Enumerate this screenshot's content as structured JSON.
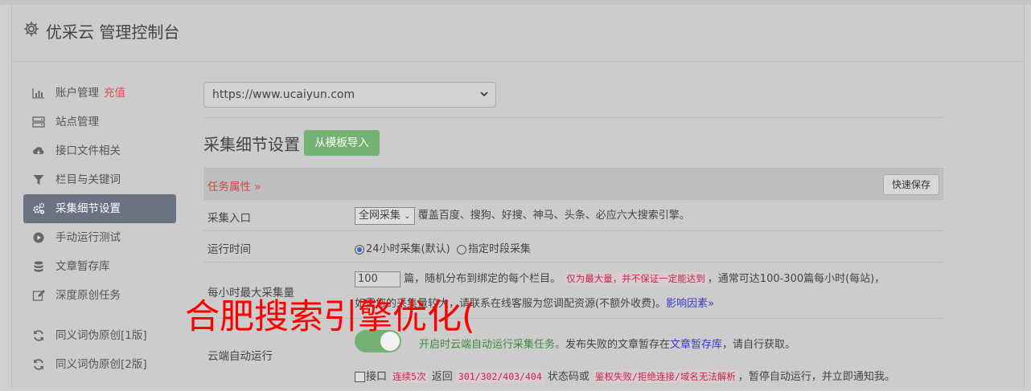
{
  "header": {
    "title": "优采云 管理控制台"
  },
  "sidebar": {
    "items": [
      {
        "label": "账户管理",
        "tag": "充值",
        "icon": "bar-chart-icon"
      },
      {
        "label": "站点管理",
        "icon": "server-icon"
      },
      {
        "label": "接口文件相关",
        "icon": "cloud-download-icon"
      },
      {
        "label": "栏目与关键词",
        "icon": "filter-icon"
      },
      {
        "label": "采集细节设置",
        "icon": "gears-icon",
        "active": true
      },
      {
        "label": "手动运行测试",
        "icon": "play-circle-icon"
      },
      {
        "label": "文章暂存库",
        "icon": "database-icon"
      },
      {
        "label": "深度原创任务",
        "icon": "edit-icon"
      },
      {
        "label": "同义词伪原创[1版]",
        "icon": "refresh-icon"
      },
      {
        "label": "同义词伪原创[2版]",
        "icon": "refresh-icon"
      }
    ]
  },
  "main": {
    "site_select": "https://www.ucaiyun.com",
    "section_title": "采集细节设置",
    "import_button": "从模板导入",
    "table_header": "任务属性 »",
    "save_button": "快速保存",
    "rows": {
      "entry": {
        "label": "采集入口",
        "select": "全网采集",
        "desc": "覆盖百度、搜狗、好搜、神马、头条、必应六大搜索引擎。"
      },
      "runtime": {
        "label": "运行时间",
        "opt1": "24小时采集(默认)",
        "opt2": "指定时段采集"
      },
      "max": {
        "label": "每小时最大采集量",
        "value": "100",
        "t1": "篇，随机分布到绑定的每个栏目。",
        "t2": "仅为最大量，并不保证一定能达到",
        "t3": "，通常可达100-300篇每小时(每站)，",
        "t4": "如需您的采集量较大，请联系在线客服为您调配资源(不额外收费)。",
        "link": "影响因素»"
      },
      "cloud": {
        "label": "云端自动运行",
        "t1": "开启时云端自动运行采集任务。",
        "t2": "发布失败的文章暂存在",
        "link": "文章暂存库",
        "t3": "，请自行获取。",
        "c1": "接口",
        "code1": "连续5次",
        "c2": "返回",
        "code2": "301/302/403/404",
        "c3": "状态码或",
        "code3": "鉴权失败/拒绝连接/域名无法解析",
        "c4": "，暂停自动运行，并立即通知我。"
      }
    }
  },
  "overlay": {
    "text": "合肥搜索引擎优化("
  },
  "colors": {
    "active_bg": "#6b7281",
    "accent_green": "#73b273",
    "overlay_red": "#ff0000",
    "tag_red": "#d9534f"
  }
}
